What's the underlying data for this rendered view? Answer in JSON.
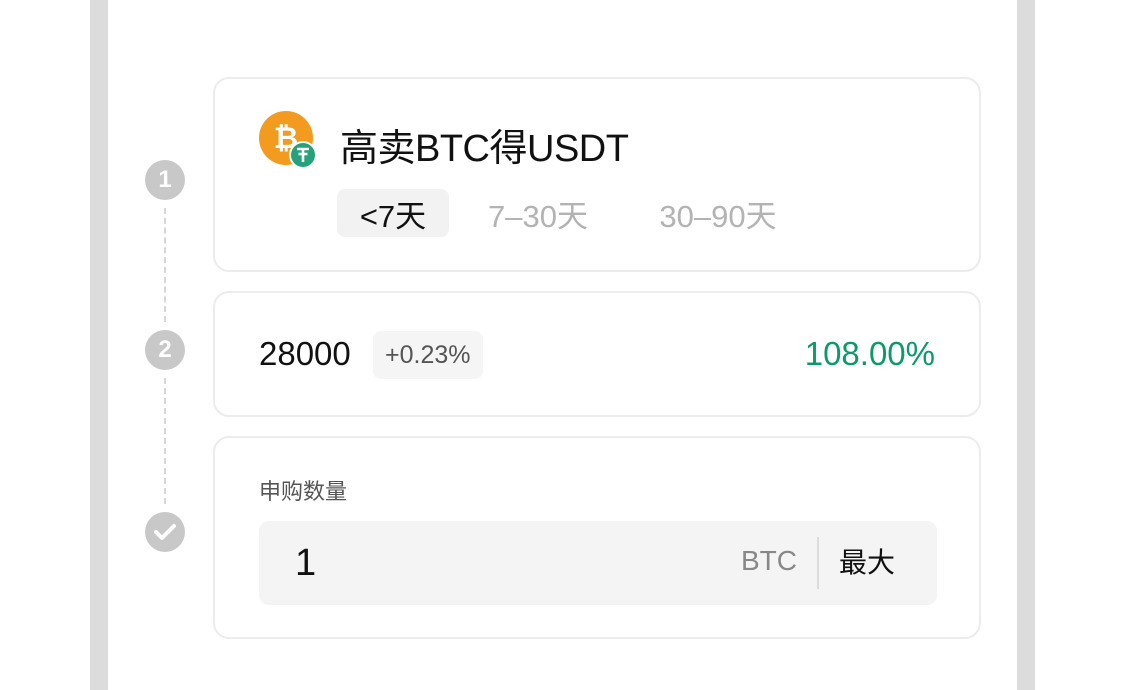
{
  "product": {
    "title": "高卖BTC得USDT",
    "coin_icon": "btc-usdt-icon",
    "terms": [
      {
        "label": "<7天",
        "active": true
      },
      {
        "label": "7–30天",
        "active": false
      },
      {
        "label": "30–90天",
        "active": false
      }
    ]
  },
  "steps": [
    "1",
    "2"
  ],
  "target": {
    "price": "28000",
    "change": "+0.23%",
    "apr": "108.00%"
  },
  "amount": {
    "label": "申购数量",
    "value": "1",
    "unit": "BTC",
    "max_label": "最大"
  },
  "colors": {
    "accent_green": "#0c9b68",
    "btc_orange": "#f39b1e",
    "usdt_green": "#26a17b"
  }
}
